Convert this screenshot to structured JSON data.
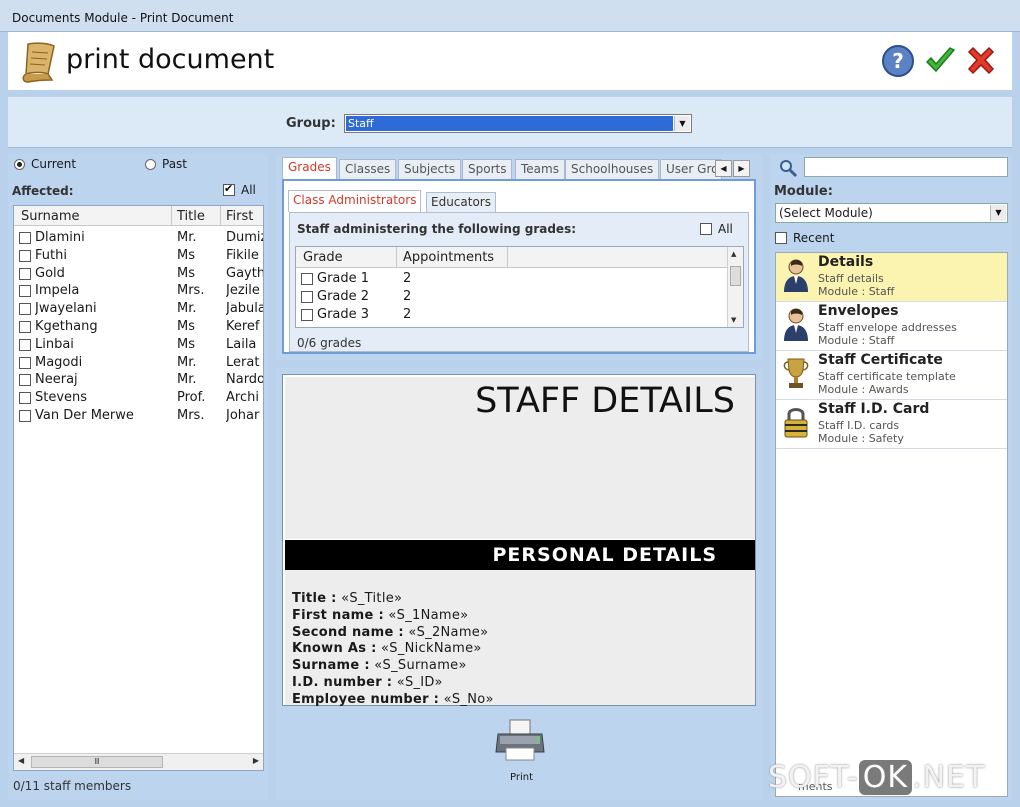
{
  "window": {
    "title": "Documents Module - Print Document"
  },
  "header": {
    "title": "print document"
  },
  "group": {
    "label": "Group:",
    "value": "Staff"
  },
  "left": {
    "radio_current": "Current",
    "radio_past": "Past",
    "affected_label": "Affected:",
    "all_label": "All",
    "columns": [
      "Surname",
      "Title",
      "First"
    ],
    "rows": [
      {
        "surname": "Dlamini",
        "title": "Mr.",
        "first": "Dumiz"
      },
      {
        "surname": "Futhi",
        "title": "Ms",
        "first": "Fikile"
      },
      {
        "surname": "Gold",
        "title": "Ms",
        "first": "Gayth"
      },
      {
        "surname": "Impela",
        "title": "Mrs.",
        "first": "Jezile"
      },
      {
        "surname": "Jwayelani",
        "title": "Mr.",
        "first": "Jabula"
      },
      {
        "surname": "Kgethang",
        "title": "Ms",
        "first": "Keref"
      },
      {
        "surname": "Linbai",
        "title": "Ms",
        "first": "Laila"
      },
      {
        "surname": "Magodi",
        "title": "Mr.",
        "first": "Lerat"
      },
      {
        "surname": "Neeraj",
        "title": "Mr.",
        "first": "Nardo"
      },
      {
        "surname": "Stevens",
        "title": "Prof.",
        "first": "Archi"
      },
      {
        "surname": "Van Der Merwe",
        "title": "Mrs.",
        "first": "Johar"
      }
    ],
    "status": "0/11 staff members"
  },
  "tabs": [
    "Grades",
    "Classes",
    "Subjects",
    "Sports",
    "Teams",
    "Schoolhouses",
    "User Gro"
  ],
  "subtabs": [
    "Class Administrators",
    "Educators"
  ],
  "grades": {
    "heading": "Staff administering the following grades:",
    "all_label": "All",
    "columns": [
      "Grade",
      "Appointments"
    ],
    "rows": [
      {
        "grade": "Grade 1",
        "appointments": "2"
      },
      {
        "grade": "Grade 2",
        "appointments": "2"
      },
      {
        "grade": "Grade 3",
        "appointments": "2"
      }
    ],
    "status": "0/6 grades"
  },
  "document": {
    "title": "STAFF DETAILS",
    "band": "PERSONAL DETAILS",
    "fields": [
      {
        "label": "Title :",
        "value": "«S_Title»"
      },
      {
        "label": "First name :",
        "value": "«S_1Name»"
      },
      {
        "label": "Second name :",
        "value": "«S_2Name»"
      },
      {
        "label": "Known As :",
        "value": "«S_NickName»"
      },
      {
        "label": "Surname :",
        "value": "«S_Surname»"
      },
      {
        "label": "I.D. number :",
        "value": "«S_ID»"
      },
      {
        "label": "Employee number :",
        "value": "«S_No»"
      }
    ],
    "print_label": "Print"
  },
  "right": {
    "module_label": "Module:",
    "module_value": "(Select Module)",
    "recent_label": "Recent",
    "modules": [
      {
        "title": "Details",
        "desc": "Staff details",
        "module": "Module : Staff",
        "icon": "person-icon"
      },
      {
        "title": "Envelopes",
        "desc": "Staff envelope addresses",
        "module": "Module : Staff",
        "icon": "person-icon"
      },
      {
        "title": "Staff Certificate",
        "desc": "Staff certificate template",
        "module": "Module : Awards",
        "icon": "trophy-icon"
      },
      {
        "title": "Staff I.D. Card",
        "desc": "Staff I.D. cards",
        "module": "Module : Safety",
        "icon": "lock-icon"
      }
    ],
    "footer_partial": "ments"
  },
  "watermark": {
    "left": "SOFT-",
    "ok": "OK",
    "right": ".NET"
  },
  "colors": {
    "accent_tab": "#d23a2a",
    "selection": "#2f6bd6",
    "selected_item": "#fbf3b0"
  }
}
